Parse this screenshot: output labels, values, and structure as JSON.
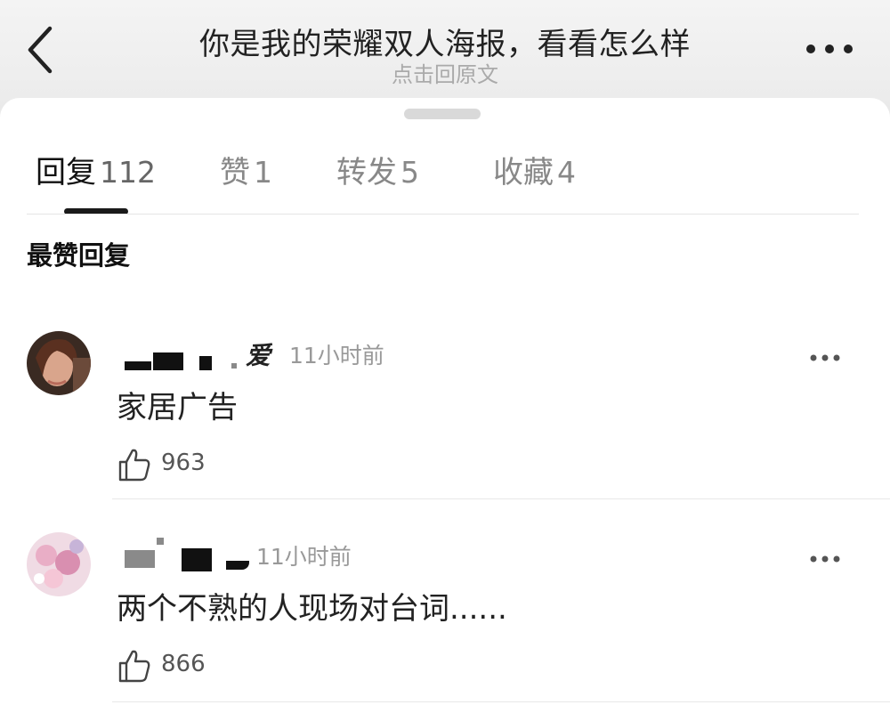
{
  "header": {
    "title": "你是我的荣耀双人海报，看看怎么样",
    "subtitle": "点击回原文"
  },
  "tabs": [
    {
      "label": "回复",
      "count": "112"
    },
    {
      "label": "赞",
      "count": "1"
    },
    {
      "label": "转发",
      "count": "5"
    },
    {
      "label": "收藏",
      "count": "4"
    }
  ],
  "section_title": "最赞回复",
  "comments": [
    {
      "username_visible": "爱",
      "time": "11小时前",
      "text": "家居广告",
      "likes": "963"
    },
    {
      "username_visible": "",
      "time": "11小时前",
      "text": "两个不熟的人现场对台词......",
      "likes": "866"
    }
  ],
  "icons": {
    "back": "chevron-left-icon",
    "more": "more-horizontal-icon",
    "like": "thumbs-up-icon"
  },
  "colors": {
    "text_primary": "#222222",
    "text_secondary": "#999999",
    "tab_indicator": "#1a1a1a"
  }
}
